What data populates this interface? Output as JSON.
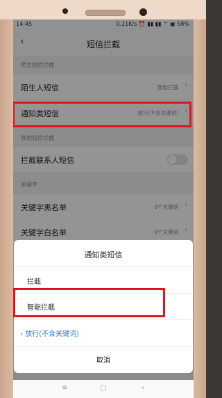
{
  "status_bar": {
    "time": "14:45",
    "right": "0.21K/s ⏰ ▮▮ ▮▮ ⌔ ▣ 58%"
  },
  "header": {
    "back_icon": "‹",
    "title": "短信拦截"
  },
  "sections": {
    "stranger": "陌生短信拦截",
    "other": "其他短信拦截",
    "keyword": "关键字"
  },
  "rows": {
    "stranger_sms": {
      "label": "陌生人短信",
      "value": "智能拦截"
    },
    "notice_sms": {
      "label": "通知类短信",
      "value": "放行(不含关键词)"
    },
    "block_contacts": {
      "label": "拦截联系人短信"
    },
    "blacklist": {
      "label": "关键字黑名单",
      "value": "0个关键词"
    },
    "whitelist": {
      "label": "关键字白名单",
      "value": "0个关键词"
    }
  },
  "sheet": {
    "title": "通知类短信",
    "options": [
      "拦截",
      "智能拦截"
    ],
    "selected": "放行(不含关键词)",
    "cancel": "取消"
  },
  "nav": {
    "menu": "≡",
    "home": "▢",
    "back": "‹"
  },
  "colors": {
    "highlight": "#e0141c",
    "accent": "#2e7ad8"
  }
}
